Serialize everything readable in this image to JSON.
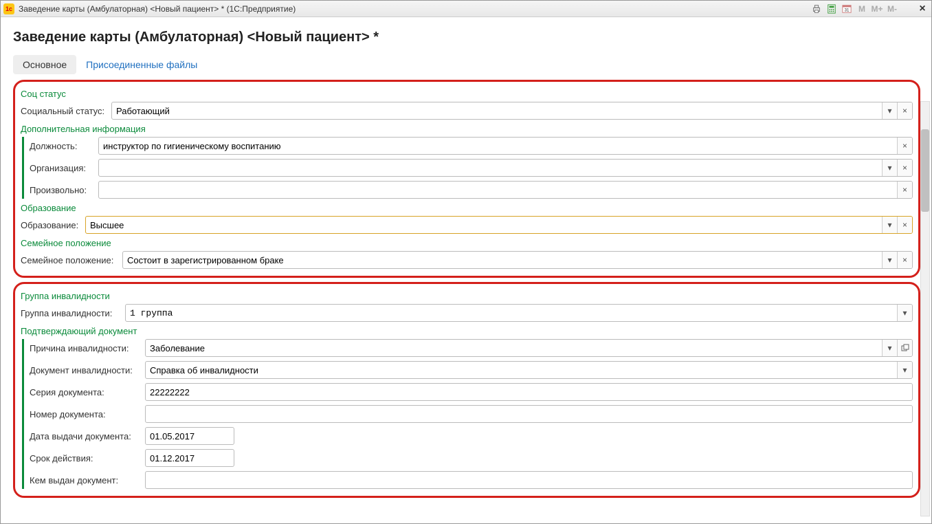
{
  "titlebar": {
    "title": "Заведение карты (Амбулаторная) <Новый пациент> *  (1С:Предприятие)",
    "icons": {
      "m": "M",
      "mplus": "M+",
      "mminus": "M-"
    }
  },
  "header": {
    "page_title": "Заведение карты (Амбулаторная) <Новый пациент> *"
  },
  "tabs": {
    "main": "Основное",
    "files": "Присоединенные файлы"
  },
  "sections": {
    "soc_status": {
      "title": "Соц статус",
      "label": "Социальный статус:",
      "value": "Работающий"
    },
    "extra": {
      "title": "Дополнительная информация",
      "position_label": "Должность:",
      "position_value": "инструктор по гигиеническому воспитанию",
      "org_label": "Организация:",
      "org_value": "",
      "free_label": "Произвольно:",
      "free_value": ""
    },
    "education": {
      "title": "Образование",
      "label": "Образование:",
      "value": "Высшее"
    },
    "marital": {
      "title": "Семейное положение",
      "label": "Семейное положение:",
      "value": "Состоит в зарегистрированном браке"
    },
    "disability_group": {
      "title": "Группа инвалидности",
      "label": "Группа инвалидности:",
      "value": "1 группа"
    },
    "confirm_doc": {
      "title": "Подтверждающий документ",
      "reason_label": "Причина инвалидности:",
      "reason_value": "Заболевание",
      "doc_label": "Документ инвалидности:",
      "doc_value": "Справка об инвалидности",
      "series_label": "Серия документа:",
      "series_value": "22222222",
      "number_label": "Номер документа:",
      "number_value": "",
      "issue_date_label": "Дата выдачи документа:",
      "issue_date_value": "01.05.2017",
      "valid_label": "Срок действия:",
      "valid_value": "01.12.2017",
      "issued_by_label": "Кем выдан документ:",
      "issued_by_value": ""
    }
  }
}
